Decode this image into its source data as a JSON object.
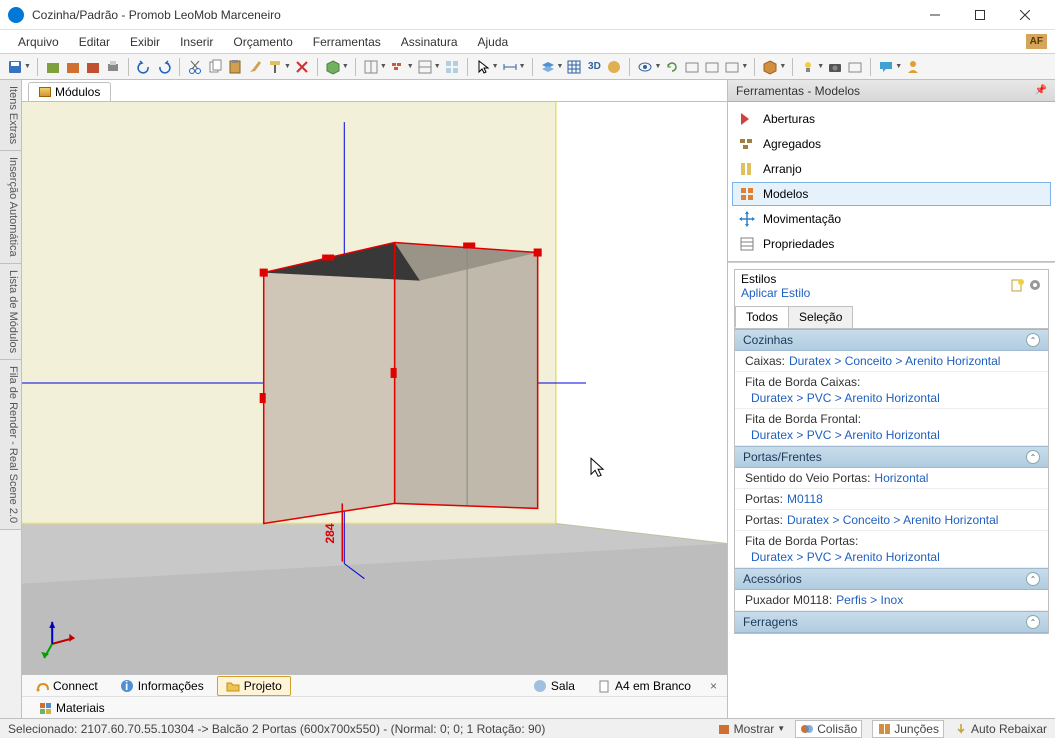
{
  "window": {
    "title": "Cozinha/Padrão - Promob LeoMob Marceneiro"
  },
  "menu": [
    "Arquivo",
    "Editar",
    "Exibir",
    "Inserir",
    "Orçamento",
    "Ferramentas",
    "Assinatura",
    "Ajuda"
  ],
  "af_badge": "AF",
  "left_tabs": [
    "Itens Extras",
    "Inserção Automática",
    "Lista de Módulos",
    "Fila de Render - Real Scene 2.0"
  ],
  "top_tab": "Módulos",
  "dimension_label": "284",
  "bottom_tabs": {
    "connect": "Connect",
    "info": "Informações",
    "projeto": "Projeto",
    "sala": "Sala",
    "a4": "A4 em Branco"
  },
  "materials_tab": "Materiais",
  "right_panel": {
    "title": "Ferramentas - Modelos",
    "nav": [
      {
        "label": "Aberturas",
        "color": "#d04040"
      },
      {
        "label": "Agregados",
        "color": "#a08040"
      },
      {
        "label": "Arranjo",
        "color": "#c0a040"
      },
      {
        "label": "Modelos",
        "color": "#d07020",
        "selected": true
      },
      {
        "label": "Movimentação",
        "color": "#3080d0"
      },
      {
        "label": "Propriedades",
        "color": "#808080"
      }
    ],
    "estilos_label": "Estilos",
    "aplicar_estilo": "Aplicar Estilo",
    "tabs": {
      "todos": "Todos",
      "selecao": "Seleção"
    },
    "groups": [
      {
        "title": "Cozinhas",
        "rows": [
          {
            "type": "inline",
            "label": "Caixas:",
            "link": "Duratex > Conceito > Arenito Horizontal"
          },
          {
            "type": "stacked",
            "label": "Fita de Borda Caixas:",
            "link": "Duratex > PVC > Arenito Horizontal"
          },
          {
            "type": "stacked",
            "label": "Fita de Borda Frontal:",
            "link": "Duratex > PVC > Arenito Horizontal"
          }
        ]
      },
      {
        "title": "Portas/Frentes",
        "rows": [
          {
            "type": "inline",
            "label": "Sentido do Veio Portas:",
            "link": "Horizontal"
          },
          {
            "type": "inline",
            "label": "Portas:",
            "link": "M0118"
          },
          {
            "type": "inline",
            "label": "Portas:",
            "link": "Duratex > Conceito > Arenito Horizontal"
          },
          {
            "type": "stacked",
            "label": "Fita de Borda Portas:",
            "link": "Duratex > PVC > Arenito Horizontal"
          }
        ]
      },
      {
        "title": "Acessórios",
        "rows": [
          {
            "type": "inline",
            "label": "Puxador M0118:",
            "link": "Perfis > Inox"
          }
        ]
      },
      {
        "title": "Ferragens",
        "rows": []
      }
    ]
  },
  "status": {
    "selection": "Selecionado: 2107.60.70.55.10304 -> Balcão 2 Portas (600x700x550) - (Normal: 0; 0; 1 Rotação: 90)",
    "mostrar": "Mostrar",
    "colisao": "Colisão",
    "juncoes": "Junções",
    "auto_rebaixar": "Auto Rebaixar"
  }
}
